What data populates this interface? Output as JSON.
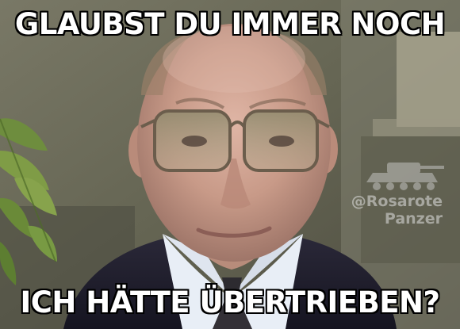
{
  "meme": {
    "top_text": "GLAUBST DU IMMER NOCH",
    "bottom_text": "ICH HÄTTE ÜBERTRIEBEN?"
  },
  "watermark": {
    "handle": "@Rosarote",
    "name": "Panzer"
  },
  "photo": {
    "subject": "man-with-tinted-glasses-in-suit",
    "icons": [
      "plant-leaves-icon",
      "tank-watermark-icon"
    ]
  },
  "colors": {
    "caption_text": "#ffffff",
    "caption_outline": "#000000",
    "background_wall": "#5f5e4c",
    "suit": "#1f1d2f",
    "shirt": "#e8eef6"
  }
}
